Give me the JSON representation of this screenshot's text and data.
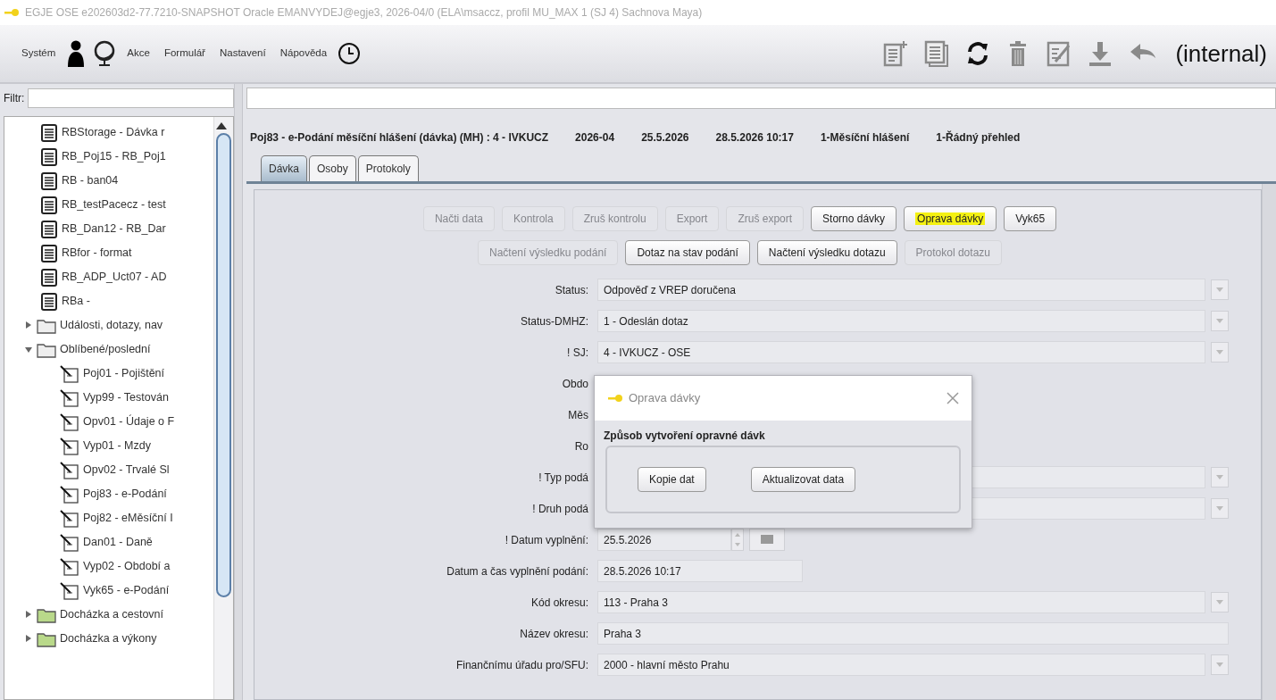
{
  "window": {
    "title": "EGJE OSE e202603d2-77.7210-SNAPSHOT Oracle EMANVYDEJ@egje3, 2026-04/0  (ELA\\msaccz, profil MU_MAX 1 (SJ 4) Sachnova Maya)"
  },
  "menu": [
    {
      "kind": "text",
      "label": "Systém"
    },
    {
      "kind": "person"
    },
    {
      "kind": "globe"
    },
    {
      "kind": "text",
      "label": "Akce"
    },
    {
      "kind": "text",
      "label": "Formulář"
    },
    {
      "kind": "text",
      "label": "Nastavení"
    },
    {
      "kind": "text",
      "label": "Nápověda"
    },
    {
      "kind": "clock"
    }
  ],
  "toolbar": {
    "tools": [
      {
        "kind": "new",
        "enabled": false
      },
      {
        "kind": "copy",
        "enabled": false
      },
      {
        "kind": "refresh",
        "enabled": true
      },
      {
        "kind": "delete",
        "enabled": false
      },
      {
        "kind": "edit",
        "enabled": false
      },
      {
        "kind": "download",
        "enabled": false
      },
      {
        "kind": "back",
        "enabled": false
      }
    ],
    "label": "(internal)"
  },
  "filter": {
    "label": "Filtr:"
  },
  "tree": [
    {
      "kind": "report",
      "label": "RBStorage - Dávka r"
    },
    {
      "kind": "report",
      "label": "RB_Poj15 - RB_Poj1"
    },
    {
      "kind": "report",
      "label": "RB - ban04"
    },
    {
      "kind": "report",
      "label": "RB_testPacecz - test"
    },
    {
      "kind": "report",
      "label": "RB_Dan12 - RB_Dar"
    },
    {
      "kind": "report",
      "label": "RBfor - format"
    },
    {
      "kind": "report",
      "label": "RB_ADP_Uct07 - AD"
    },
    {
      "kind": "report",
      "label": "RBa -"
    },
    {
      "kind": "folder",
      "label": "Události, dotazy, nav",
      "expanded": false,
      "color": "#eeeeee"
    },
    {
      "kind": "folder",
      "label": "Oblíbené/poslední",
      "expanded": true,
      "color": "#eeeeee",
      "children": [
        {
          "kind": "form",
          "label": "Poj01 - Pojištění"
        },
        {
          "kind": "form",
          "label": "Vyp99 - Testován"
        },
        {
          "kind": "form",
          "label": "Opv01 - Údaje o F"
        },
        {
          "kind": "form",
          "label": "Vyp01 - Mzdy"
        },
        {
          "kind": "form",
          "label": "Opv02 - Trvalé Sl"
        },
        {
          "kind": "form",
          "label": "Poj83 - e-Podání"
        },
        {
          "kind": "form",
          "label": "Poj82 - eMěsíční I"
        },
        {
          "kind": "form",
          "label": "Dan01 - Daně"
        },
        {
          "kind": "form",
          "label": "Vyp02 - Období a"
        },
        {
          "kind": "form",
          "label": "Vyk65 - e-Podání"
        }
      ]
    },
    {
      "kind": "folder",
      "label": "Docházka a cestovní",
      "expanded": false,
      "color": "#b9d98a"
    },
    {
      "kind": "folder",
      "label": "Docházka a výkony",
      "expanded": false,
      "color": "#b9d98a"
    }
  ],
  "header": [
    "Poj83 - e-Podání měsíční hlášení (dávka) (MH) : 4 - IVKUCZ",
    "2026-04",
    "25.5.2026",
    "28.5.2026 10:17",
    "1-Měsíční hlášení",
    "1-Řádný přehled"
  ],
  "tabs": [
    {
      "label": "Dávka",
      "selected": true
    },
    {
      "label": "Osoby",
      "selected": false
    },
    {
      "label": "Protokoly",
      "selected": false
    }
  ],
  "button_rows": [
    [
      {
        "label": "Načti data",
        "disabled": true,
        "highlighted": false
      },
      {
        "label": "Kontrola",
        "disabled": true,
        "highlighted": false
      },
      {
        "label": "Zruš kontrolu",
        "disabled": true,
        "highlighted": false
      },
      {
        "label": "Export",
        "disabled": true,
        "highlighted": false
      },
      {
        "label": "Zruš export",
        "disabled": true,
        "highlighted": false
      },
      {
        "label": "Storno dávky",
        "disabled": false,
        "highlighted": false
      },
      {
        "label": "Oprava dávky",
        "disabled": false,
        "highlighted": true
      },
      {
        "label": "Vyk65",
        "disabled": false,
        "highlighted": false
      }
    ],
    [
      {
        "label": "Načtení výsledku podání",
        "disabled": true,
        "highlighted": false
      },
      {
        "label": "Dotaz na stav podání",
        "disabled": false,
        "highlighted": false
      },
      {
        "label": "Načtení výsledku dotazu",
        "disabled": false,
        "highlighted": false
      },
      {
        "label": "Protokol dotazu",
        "disabled": true,
        "highlighted": false
      }
    ]
  ],
  "form": [
    {
      "kind": "combo",
      "label": "Status:",
      "value": "Odpověď z VREP doručena"
    },
    {
      "kind": "combo",
      "label": "Status-DMHZ:",
      "value": "1 - Odeslán dotaz"
    },
    {
      "kind": "combo",
      "label": "! SJ:",
      "value": "4 - IVKUCZ - OSE"
    },
    {
      "kind": "covered",
      "label": "Obdo"
    },
    {
      "kind": "covered",
      "label": "Měs"
    },
    {
      "kind": "covered",
      "label": "Ro"
    },
    {
      "kind": "combo",
      "label": "! Typ podá"
    },
    {
      "kind": "combo",
      "label": "! Druh podá"
    },
    {
      "kind": "date",
      "label": "! Datum vyplnění:",
      "value": "25.5.2026"
    },
    {
      "kind": "short",
      "label": "Datum a čas vyplnění podání:",
      "value": "28.5.2026 10:17"
    },
    {
      "kind": "combo",
      "label": "Kód okresu:",
      "value": "113 - Praha 3"
    },
    {
      "kind": "text",
      "label": "Název okresu:",
      "value": "Praha 3"
    },
    {
      "kind": "combo",
      "label": "Finančnímu úřadu pro/SFU:",
      "value": "2000 - hlavní město Prahu"
    }
  ],
  "dialog": {
    "title": "Oprava dávky",
    "group_label": "Způsob vytvoření opravné dávk",
    "buttons": [
      "Kopie dat",
      "Aktualizovat data"
    ]
  }
}
